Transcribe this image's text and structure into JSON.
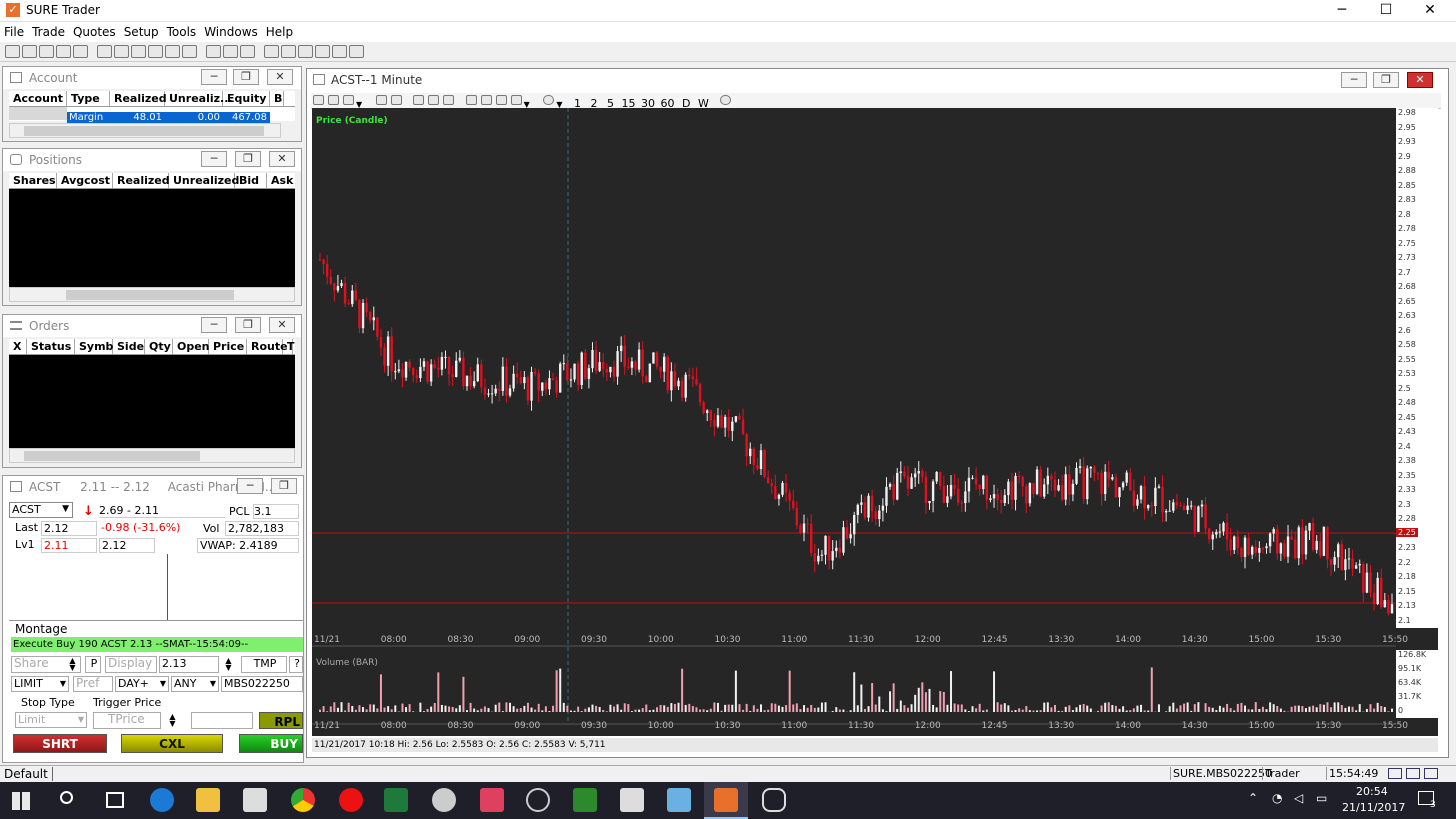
{
  "app": {
    "title": "SURE Trader",
    "min": "─",
    "max": "☐",
    "close": "✕"
  },
  "menu": [
    "File",
    "Trade",
    "Quotes",
    "Setup",
    "Tools",
    "Windows",
    "Help"
  ],
  "account": {
    "title": "Account",
    "columns": [
      "Account",
      "Type",
      "Realized",
      "Unrealiz...",
      "Equity",
      "B"
    ],
    "row": {
      "account": "",
      "type": "Margin",
      "realized": "48.01",
      "unrealized": "0.00",
      "equity": "467.08"
    }
  },
  "positions": {
    "title": "Positions",
    "columns": [
      "Shares",
      "Avgcost",
      "Realized",
      "Unrealized",
      "Bid",
      "Ask"
    ]
  },
  "orders": {
    "title": "Orders",
    "columns": [
      "X",
      "Status",
      "Symb",
      "Side",
      "Qty",
      "Open",
      "Price",
      "Route",
      "T"
    ]
  },
  "montage": {
    "title": "ACST",
    "quote": "2.11 -- 2.12",
    "company": "Acasti Pharma, I...",
    "symbol": "ACST",
    "range": "2.69 - 2.11",
    "pcl_label": "PCL",
    "pcl": "3.1",
    "last_label": "Last",
    "last": "2.12",
    "change": "-0.98  (-31.6%)",
    "vol_label": "Vol",
    "vol": "2,782,183",
    "lv1_label": "Lv1",
    "bid": "2.11",
    "ask": "2.12",
    "vwap": "VWAP: 2.4189",
    "tab": "Montage",
    "exec_msg": "Execute Buy 190 ACST 2.13 --SMAT--15:54:09--",
    "share_ph": "Share",
    "p_btn": "P",
    "display_ph": "Display",
    "price": "2.13",
    "tmp": "TMP",
    "q": "?",
    "order_type": "LIMIT",
    "pref_ph": "Pref",
    "tif": "DAY+",
    "route": "ANY",
    "account_id": "MBS022250",
    "stop_type_label": "Stop Type",
    "trigger_label": "Trigger Price",
    "stop_ph": "Limit",
    "tprice_ph": "TPrice",
    "rpl": "RPL",
    "shrt": "SHRT",
    "cxl": "CXL",
    "buy": "BUY"
  },
  "chart": {
    "window_title": "ACST--1 Minute",
    "tf_buttons": [
      "1",
      "2",
      "5",
      "15",
      "30",
      "60",
      "D",
      "W"
    ],
    "price_label": "Price (Candle)",
    "volume_label": "Volume (BAR)",
    "last_price": "2.12",
    "red_line_label": "2.25",
    "info_bar": "11/21/2017 10:18  Hi: 2.56  Lo: 2.5583  O: 2.56  C: 2.5583  V: 5,711",
    "x_labels": [
      "11/21",
      "08:00",
      "08:30",
      "09:00",
      "09:30",
      "10:00",
      "10:30",
      "11:00",
      "11:30",
      "12:00",
      "12:45",
      "13:30",
      "14:00",
      "14:30",
      "15:00",
      "15:30",
      "15:50"
    ],
    "y_labels": [
      "2.98",
      "2.95",
      "2.93",
      "2.9",
      "2.88",
      "2.85",
      "2.83",
      "2.8",
      "2.78",
      "2.75",
      "2.73",
      "2.7",
      "2.68",
      "2.65",
      "2.63",
      "2.6",
      "2.58",
      "2.55",
      "2.53",
      "2.5",
      "2.48",
      "2.45",
      "2.43",
      "2.4",
      "2.38",
      "2.35",
      "2.33",
      "2.3",
      "2.28",
      "2.25",
      "2.23",
      "2.2",
      "2.18",
      "2.15",
      "2.13",
      "2.1"
    ],
    "vol_y_labels": [
      "126.8K",
      "95.1K",
      "63.4K",
      "31.7K",
      "0"
    ]
  },
  "chart_data": {
    "type": "line",
    "x": [
      "08:00",
      "08:30",
      "09:00",
      "09:30",
      "10:00",
      "10:30",
      "11:00",
      "11:30",
      "12:00",
      "12:45",
      "13:30",
      "14:00",
      "14:30",
      "15:00",
      "15:30",
      "15:50"
    ],
    "series": [
      {
        "name": "Price (Candle)",
        "values": [
          2.72,
          2.55,
          2.52,
          2.5,
          2.55,
          2.52,
          2.4,
          2.21,
          2.33,
          2.33,
          2.33,
          2.34,
          2.3,
          2.22,
          2.24,
          2.12
        ]
      }
    ],
    "ylim": [
      2.1,
      2.98
    ]
  },
  "status": {
    "tab": "Default",
    "account": "SURE.MBS022250",
    "role": "Trader",
    "time": "15:54:49"
  },
  "taskbar": {
    "time": "20:54",
    "date": "21/11/2017",
    "notif": "3"
  }
}
